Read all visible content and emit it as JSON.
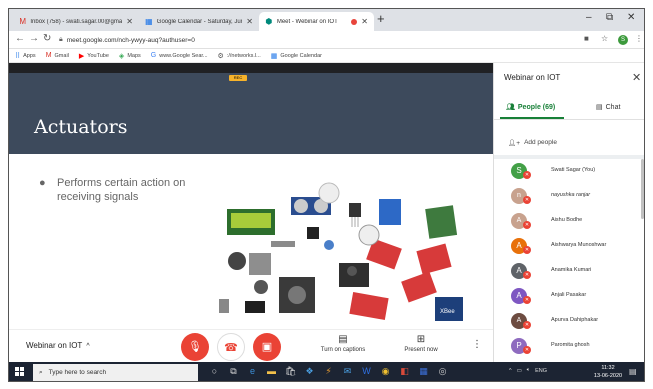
{
  "browser": {
    "tabs": [
      {
        "icon": "M",
        "icon_color": "#d93025",
        "title": "Inbox (758) - swati.sagar.00@gmail.com"
      },
      {
        "icon": "▦",
        "icon_color": "#1a73e8",
        "title": "Google Calendar - Saturday, June"
      },
      {
        "icon": "⬢",
        "icon_color": "#00897b",
        "title": "Meet - Webinar on IOT"
      }
    ],
    "new_tab": "+",
    "window_controls": [
      "–",
      "⧉",
      "✕"
    ],
    "url": "meet.google.com/nch-ywyy-auq?authuser=0",
    "bookmarks": [
      {
        "icon": "⠿",
        "label": "Apps"
      },
      {
        "icon": "M",
        "label": "Gmail"
      },
      {
        "icon": "▶",
        "label": "YouTube"
      },
      {
        "icon": "◈",
        "label": "Maps"
      },
      {
        "icon": "G",
        "label": "www.Google Sear..."
      },
      {
        "icon": "⚙",
        "label": "://networks.l..."
      },
      {
        "icon": "▦",
        "label": "Google Calendar"
      }
    ]
  },
  "meet": {
    "rec_badge": "REC",
    "slide": {
      "title": "Actuators",
      "bullet": "Performs certain action on receiving signals"
    },
    "meeting_name": "Webinar on IOT",
    "captions_label": "Turn on captions",
    "present_label": "Present now"
  },
  "panel": {
    "title": "Webinar on IOT",
    "people_tab": "People (69)",
    "chat_tab": "Chat",
    "add_people": "Add people",
    "participants": [
      {
        "initial": "S",
        "color": "#43a047",
        "name": "Swati Sagar (You)"
      },
      {
        "initial": "n",
        "color": "#c8a28e",
        "name": "nayushka ranjar",
        "photo": true,
        "italic": true
      },
      {
        "initial": "A",
        "color": "#c8a28e",
        "name": "Aishu Bodhe",
        "photo": true
      },
      {
        "initial": "A",
        "color": "#e8710a",
        "name": "Aishwarya Munoshwar"
      },
      {
        "initial": "A",
        "color": "#5f6368",
        "name": "Anamika Kumari"
      },
      {
        "initial": "A",
        "color": "#7e57c2",
        "name": "Anjali Pasakar"
      },
      {
        "initial": "A",
        "color": "#6d4c41",
        "name": "Apurva Dahiphakar",
        "photo": true
      },
      {
        "initial": "P",
        "color": "#8e6bbf",
        "name": "Paromita ghosh"
      }
    ]
  },
  "taskbar": {
    "search_placeholder": "Type here to search",
    "tray_lang": "ENG",
    "time": "11:32",
    "date": "13-06-2020"
  }
}
